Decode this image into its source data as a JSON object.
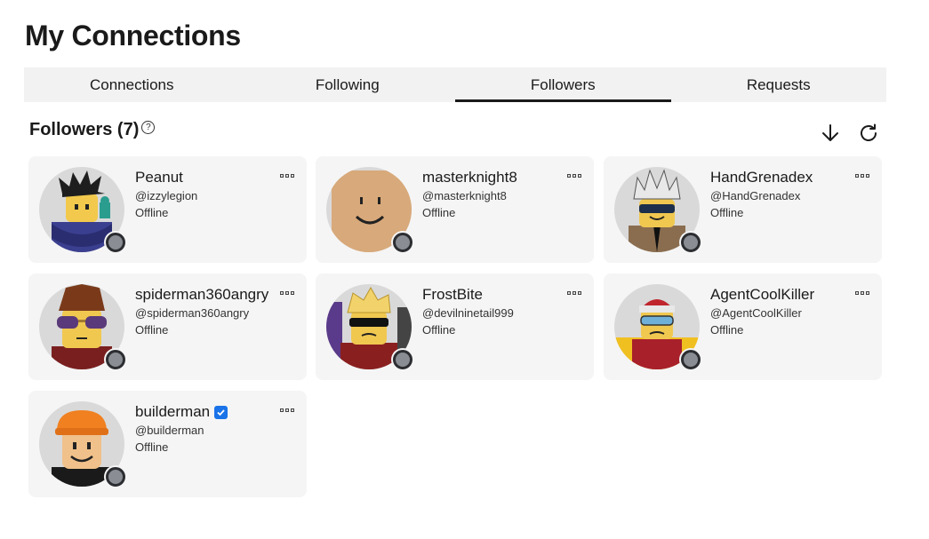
{
  "page_title": "My Connections",
  "tabs": [
    {
      "label": "Connections",
      "active": false
    },
    {
      "label": "Following",
      "active": false
    },
    {
      "label": "Followers",
      "active": true
    },
    {
      "label": "Requests",
      "active": false
    }
  ],
  "section": {
    "title": "Followers (7)",
    "help_icon": "question-circle-icon",
    "sort_icon": "arrow-down-icon",
    "refresh_icon": "refresh-icon"
  },
  "followers": [
    {
      "name": "Peanut",
      "handle": "@izzylegion",
      "status": "Offline",
      "verified": false
    },
    {
      "name": "masterknight8",
      "handle": "@masterknight8",
      "status": "Offline",
      "verified": false
    },
    {
      "name": "HandGrenadex",
      "handle": "@HandGrenadex",
      "status": "Offline",
      "verified": false
    },
    {
      "name": "spiderman360angry",
      "handle": "@spiderman360angry",
      "status": "Offline",
      "verified": false
    },
    {
      "name": "FrostBite",
      "handle": "@devilninetail999",
      "status": "Offline",
      "verified": false
    },
    {
      "name": "AgentCoolKiller",
      "handle": "@AgentCoolKiller",
      "status": "Offline",
      "verified": false
    },
    {
      "name": "builderman",
      "handle": "@builderman",
      "status": "Offline",
      "verified": true
    }
  ],
  "colors": {
    "accent_underline": "#1a1a1a",
    "tab_bar_bg": "#f2f2f2",
    "card_bg": "#f5f5f5",
    "offline_dot": "#8a8e94",
    "verified_badge": "#1a73e8"
  }
}
